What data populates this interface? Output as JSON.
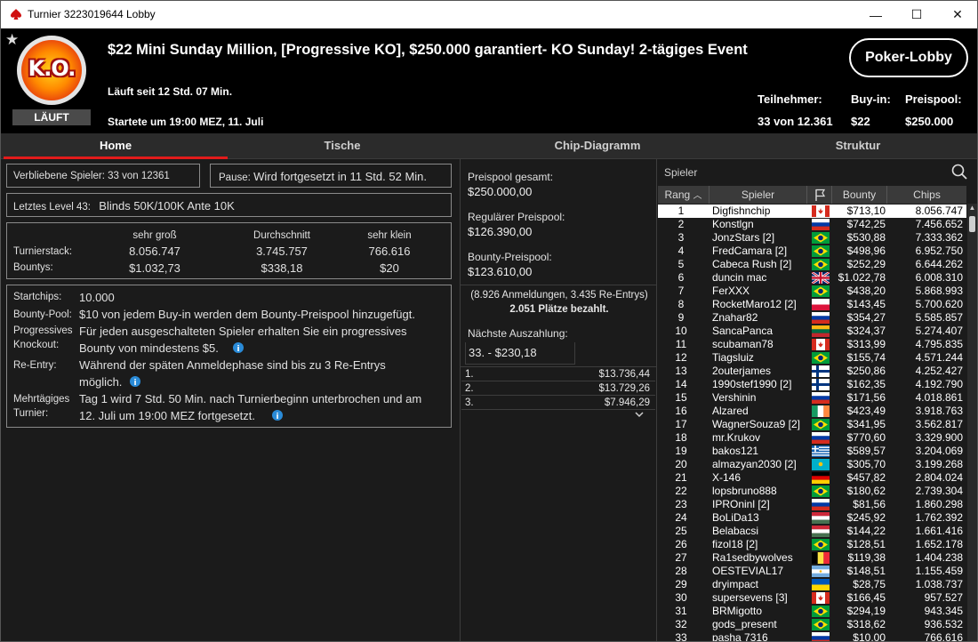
{
  "window": {
    "title": "Turnier 3223019644 Lobby",
    "minimize": "—",
    "maximize": "☐",
    "close": "✕"
  },
  "header": {
    "status": "LÄUFT",
    "tournament_name": "$22 Mini Sunday Million, [Progressive KO], $250.000 garantiert- KO Sunday! 2-tägiges Event",
    "running_for": "Läuft seit 12 Std. 07 Min.",
    "started": "Startete um 19:00 MEZ, 11. Juli",
    "lobby_button": "Poker-Lobby",
    "entrants_label": "Teilnehmer:",
    "entrants_value": "33 von 12.361",
    "buyin_label": "Buy-in:",
    "buyin_value": "$22",
    "prizepool_label": "Preispool:",
    "prizepool_value": "$250.000"
  },
  "tabs": [
    "Home",
    "Tische",
    "Chip-Diagramm",
    "Struktur"
  ],
  "home": {
    "remaining": "Verbliebene Spieler: 33 von 12361",
    "pause_label": "Pause:",
    "pause_value": "Wird fortgesetzt in 11 Std. 52 Min.",
    "level_label": "Letztes Level 43:",
    "level_value": "Blinds 50K/100K Ante 10K",
    "stack_cols": [
      "sehr groß",
      "Durchschnitt",
      "sehr klein"
    ],
    "stack_label": "Turnierstack:",
    "stack_values": [
      "8.056.747",
      "3.745.757",
      "766.616"
    ],
    "bounty_label": "Bountys:",
    "bounty_values": [
      "$1.032,73",
      "$338,18",
      "$20"
    ],
    "info": {
      "startchips_label": "Startchips:",
      "startchips_value": "10.000",
      "bountypool_label": "Bounty-Pool:",
      "bountypool_value": "$10 von jedem Buy-in werden dem Bounty-Preispool hinzugefügt.",
      "pko_label1": "Progressives",
      "pko_label2": "Knockout:",
      "pko_value1": "Für jeden ausgeschalteten Spieler erhalten Sie ein progressives",
      "pko_value2": "Bounty von mindestens $5.",
      "reentry_label": "Re-Entry:",
      "reentry_value1": "Während der späten Anmeldephase sind bis zu 3 Re-Entrys",
      "reentry_value2": "möglich.",
      "multiday_label1": "Mehrtägiges",
      "multiday_label2": "Turnier:",
      "multiday_value1": "Tag 1 wird 7 Std. 50 Min. nach Turnierbeginn unterbrochen und am",
      "multiday_value2": "12. Juli um 19:00 MEZ fortgesetzt."
    }
  },
  "prizes": {
    "total_label": "Preispool gesamt:",
    "total_value": "$250.000,00",
    "regular_label": "Regulärer Preispool:",
    "regular_value": "$126.390,00",
    "bounty_label": "Bounty-Preispool:",
    "bounty_value": "$123.610,00",
    "entries_note": "(8.926 Anmeldungen, 3.435 Re-Entrys)",
    "paid_places": "2.051 Plätze bezahlt.",
    "next_payout_label": "Nächste Auszahlung:",
    "next_payout_value": "33. - $230,18",
    "payouts": [
      {
        "place": "1.",
        "amount": "$13.736,44"
      },
      {
        "place": "2.",
        "amount": "$13.729,26"
      },
      {
        "place": "3.",
        "amount": "$7.946,29"
      }
    ]
  },
  "players": {
    "search_placeholder": "Spieler",
    "headers": {
      "rank": "Rang",
      "player": "Spieler",
      "bounty": "Bounty",
      "chips": "Chips"
    },
    "rows": [
      {
        "rank": "1",
        "name": "Digfishnchip",
        "flag": "ca",
        "bounty": "$713,10",
        "chips": "8.056.747"
      },
      {
        "rank": "2",
        "name": "Konstlgn",
        "flag": "ru",
        "bounty": "$742,25",
        "chips": "7.456.652"
      },
      {
        "rank": "3",
        "name": "JonzStars [2]",
        "flag": "br",
        "bounty": "$530,88",
        "chips": "7.333.362"
      },
      {
        "rank": "4",
        "name": "FredCamara [2]",
        "flag": "br",
        "bounty": "$498,96",
        "chips": "6.952.750"
      },
      {
        "rank": "5",
        "name": "Cabeca Rush [2]",
        "flag": "br",
        "bounty": "$252,29",
        "chips": "6.644.262"
      },
      {
        "rank": "6",
        "name": "duncin mac",
        "flag": "gb",
        "bounty": "$1.022,78",
        "chips": "6.008.310"
      },
      {
        "rank": "7",
        "name": "FerXXX",
        "flag": "br",
        "bounty": "$438,20",
        "chips": "5.868.993"
      },
      {
        "rank": "8",
        "name": "RocketMaro12 [2]",
        "flag": "pl",
        "bounty": "$143,45",
        "chips": "5.700.620"
      },
      {
        "rank": "9",
        "name": "Znahar82",
        "flag": "ru",
        "bounty": "$354,27",
        "chips": "5.585.857"
      },
      {
        "rank": "10",
        "name": "SancaPanca",
        "flag": "lt",
        "bounty": "$324,37",
        "chips": "5.274.407"
      },
      {
        "rank": "11",
        "name": "scubaman78",
        "flag": "ca",
        "bounty": "$313,99",
        "chips": "4.795.835"
      },
      {
        "rank": "12",
        "name": "Tiagsluiz",
        "flag": "br",
        "bounty": "$155,74",
        "chips": "4.571.244"
      },
      {
        "rank": "13",
        "name": "2outerjames",
        "flag": "fi",
        "bounty": "$250,86",
        "chips": "4.252.427"
      },
      {
        "rank": "14",
        "name": "1990stef1990 [2]",
        "flag": "fi",
        "bounty": "$162,35",
        "chips": "4.192.790"
      },
      {
        "rank": "15",
        "name": "Vershinin",
        "flag": "ru",
        "bounty": "$171,56",
        "chips": "4.018.861"
      },
      {
        "rank": "16",
        "name": "Alzared",
        "flag": "ie",
        "bounty": "$423,49",
        "chips": "3.918.763"
      },
      {
        "rank": "17",
        "name": "WagnerSouza9 [2]",
        "flag": "br",
        "bounty": "$341,95",
        "chips": "3.562.817"
      },
      {
        "rank": "18",
        "name": "mr.Krukov",
        "flag": "ru",
        "bounty": "$770,60",
        "chips": "3.329.900"
      },
      {
        "rank": "19",
        "name": "bakos121",
        "flag": "gr",
        "bounty": "$589,57",
        "chips": "3.204.069"
      },
      {
        "rank": "20",
        "name": "almazyan2030 [2]",
        "flag": "kz",
        "bounty": "$305,70",
        "chips": "3.199.268"
      },
      {
        "rank": "21",
        "name": "X-146",
        "flag": "de",
        "bounty": "$457,82",
        "chips": "2.804.024"
      },
      {
        "rank": "22",
        "name": "lopsbruno888",
        "flag": "br",
        "bounty": "$180,62",
        "chips": "2.739.304"
      },
      {
        "rank": "23",
        "name": "IPROninl [2]",
        "flag": "ru",
        "bounty": "$81,56",
        "chips": "1.860.298"
      },
      {
        "rank": "24",
        "name": "BoLiDa13",
        "flag": "hu",
        "bounty": "$245,92",
        "chips": "1.762.392"
      },
      {
        "rank": "25",
        "name": "Belabacsi",
        "flag": "hu",
        "bounty": "$144,22",
        "chips": "1.661.416"
      },
      {
        "rank": "26",
        "name": "fizol18 [2]",
        "flag": "br",
        "bounty": "$128,51",
        "chips": "1.652.178"
      },
      {
        "rank": "27",
        "name": "Ra1sedbywolves",
        "flag": "be",
        "bounty": "$119,38",
        "chips": "1.404.238"
      },
      {
        "rank": "28",
        "name": "OESTEVIAL17",
        "flag": "ar",
        "bounty": "$148,51",
        "chips": "1.155.459"
      },
      {
        "rank": "29",
        "name": "dryimpact",
        "flag": "ua",
        "bounty": "$28,75",
        "chips": "1.038.737"
      },
      {
        "rank": "30",
        "name": "supersevens [3]",
        "flag": "ca",
        "bounty": "$166,45",
        "chips": "957.527"
      },
      {
        "rank": "31",
        "name": "BRMigotto",
        "flag": "br",
        "bounty": "$294,19",
        "chips": "943.345"
      },
      {
        "rank": "32",
        "name": "gods_present",
        "flag": "br",
        "bounty": "$318,62",
        "chips": "936.532"
      },
      {
        "rank": "33",
        "name": "pasha 7316",
        "flag": "ru",
        "bounty": "$10,00",
        "chips": "766.616"
      }
    ]
  }
}
